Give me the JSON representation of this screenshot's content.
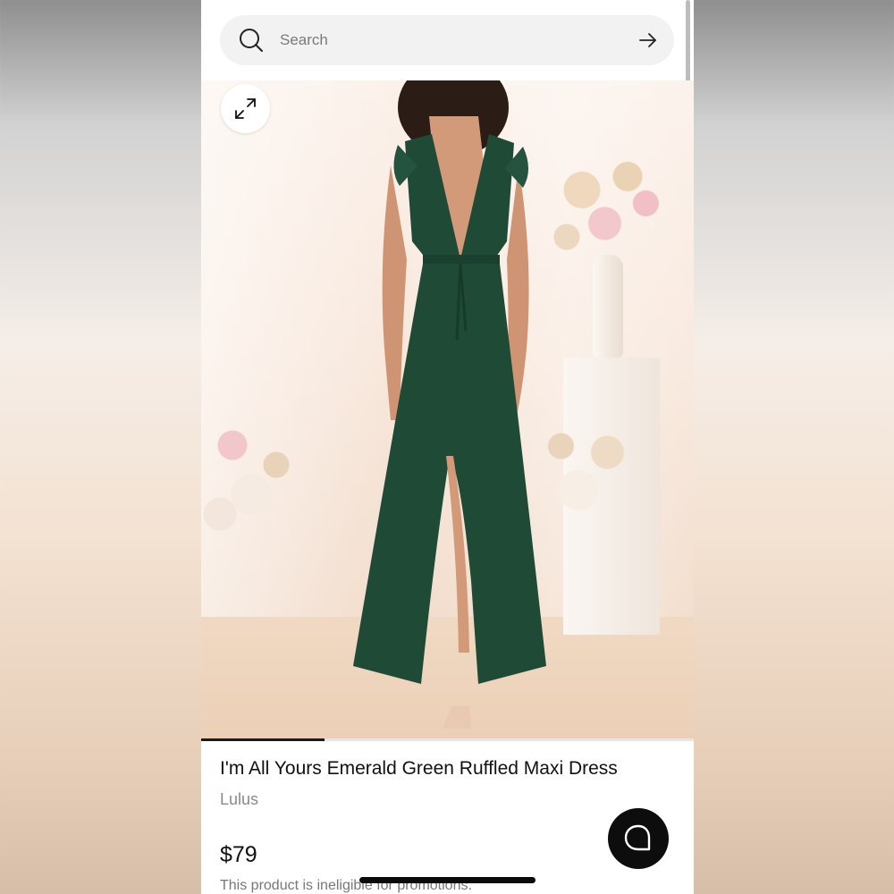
{
  "search": {
    "placeholder": "Search"
  },
  "gallery": {
    "current_image": 1,
    "progress_fraction": 0.25
  },
  "product": {
    "title": "I'm All Yours Emerald Green Ruffled Maxi Dress",
    "brand": "Lulus",
    "price": "$79",
    "promo_note": "This product is ineligible for promotions."
  },
  "icons": {
    "search": "search-icon",
    "submit": "arrow-right-icon",
    "expand": "expand-icon",
    "chat": "chat-bubble-icon"
  },
  "colors": {
    "dress": "#1f4a36",
    "chat_button": "#0d0d0d",
    "search_bg": "#f2f2f2"
  }
}
